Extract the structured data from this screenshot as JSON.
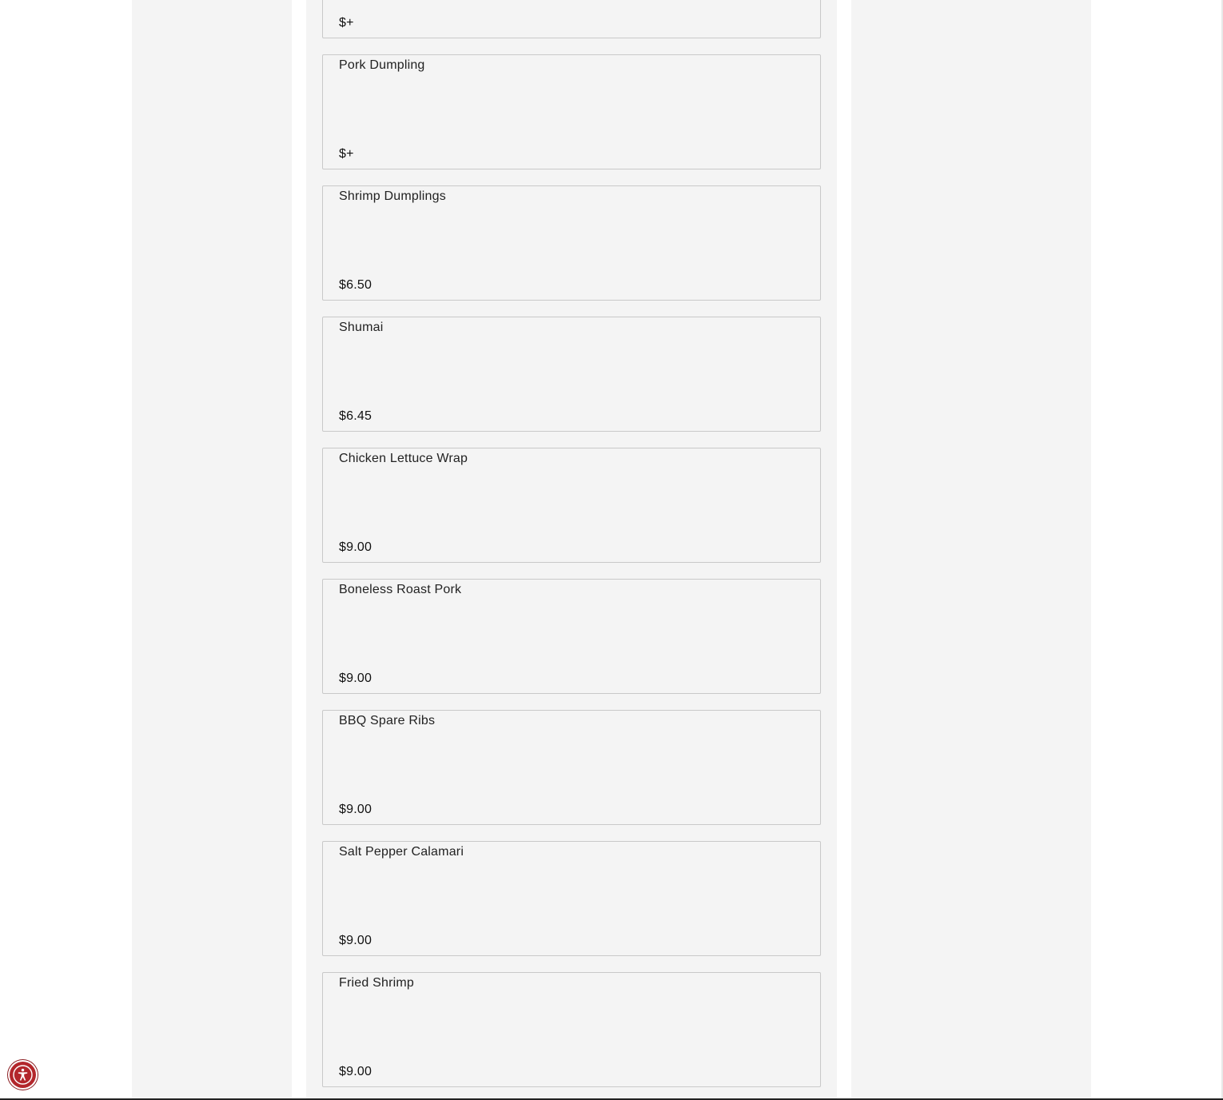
{
  "menu": {
    "items": [
      {
        "name": "",
        "price": "$+"
      },
      {
        "name": "Pork Dumpling",
        "price": "$+"
      },
      {
        "name": "Shrimp Dumplings",
        "price": "$6.50"
      },
      {
        "name": "Shumai",
        "price": "$6.45"
      },
      {
        "name": "Chicken Lettuce Wrap",
        "price": "$9.00"
      },
      {
        "name": "Boneless Roast Pork",
        "price": "$9.00"
      },
      {
        "name": "BBQ Spare Ribs",
        "price": "$9.00"
      },
      {
        "name": "Salt Pepper Calamari",
        "price": "$9.00"
      },
      {
        "name": "Fried Shrimp",
        "price": "$9.00"
      }
    ]
  },
  "accessibility": {
    "icon": "accessibility-icon",
    "color": "#b3262b"
  }
}
